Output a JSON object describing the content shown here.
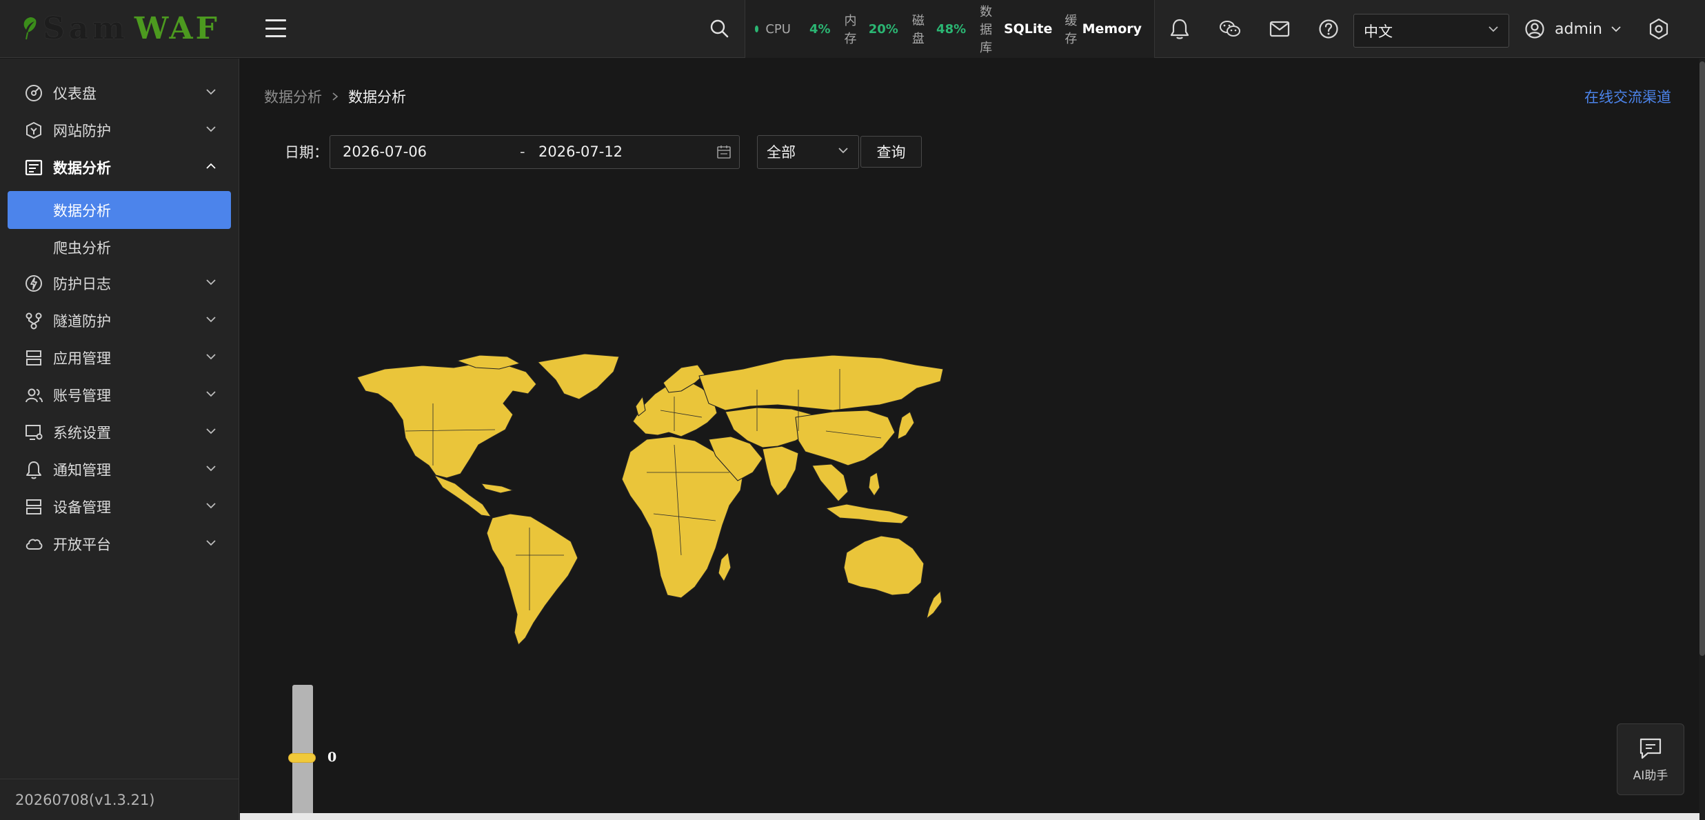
{
  "header": {
    "logo_text_1": "Sam",
    "logo_text_2": "WAF",
    "stats": {
      "cpu_label": "CPU",
      "cpu_value": "4%",
      "mem_label": "内存",
      "mem_value": "20%",
      "disk_label": "磁盘",
      "disk_value": "48%",
      "db_label": "数据库",
      "db_value": "SQLite",
      "cache_label": "缓存",
      "cache_value": "Memory"
    },
    "language": "中文",
    "username": "admin"
  },
  "sidebar": {
    "items": [
      {
        "label": "仪表盘",
        "icon": "dashboard-icon"
      },
      {
        "label": "网站防护",
        "icon": "shield-icon"
      },
      {
        "label": "数据分析",
        "icon": "data-analysis-icon"
      },
      {
        "label": "防护日志",
        "icon": "lightning-icon"
      },
      {
        "label": "隧道防护",
        "icon": "tunnel-icon"
      },
      {
        "label": "应用管理",
        "icon": "server-icon"
      },
      {
        "label": "账号管理",
        "icon": "users-icon"
      },
      {
        "label": "系统设置",
        "icon": "monitor-settings-icon"
      },
      {
        "label": "通知管理",
        "icon": "bell-icon"
      },
      {
        "label": "设备管理",
        "icon": "device-icon"
      },
      {
        "label": "开放平台",
        "icon": "cloud-icon"
      }
    ],
    "sub_items": [
      {
        "label": "数据分析",
        "active": true
      },
      {
        "label": "爬虫分析",
        "active": false
      }
    ],
    "version": "20260708(v1.3.21)"
  },
  "main": {
    "breadcrumb": [
      "数据分析",
      "数据分析"
    ],
    "online_link": "在线交流渠道",
    "filter": {
      "date_label": "日期：",
      "start_date": "2026-07-06",
      "separator": "-",
      "end_date": "2026-07-12",
      "type_value": "全部",
      "query_label": "查询"
    },
    "visual_map": {
      "value": 0,
      "label": "0",
      "color": "#f0c93a"
    },
    "ai_helper_label": "AI助手"
  },
  "colors": {
    "accent": "#4c84eb",
    "status_green": "#2bb673",
    "map_fill": "#eac53a",
    "logo_green": "#4c9a1f"
  }
}
